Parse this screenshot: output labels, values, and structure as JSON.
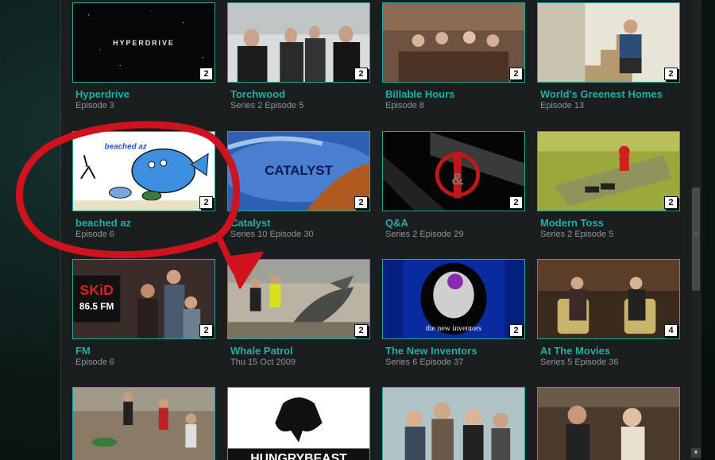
{
  "grid": {
    "tiles": [
      {
        "title": "Hyperdrive",
        "subtitle": "Episode 3",
        "badge": "2",
        "thumb_text": "HYPERDRIVE"
      },
      {
        "title": "Torchwood",
        "subtitle": "Series 2 Episode 5",
        "badge": "2"
      },
      {
        "title": "Billable Hours",
        "subtitle": "Episode 8",
        "badge": "2"
      },
      {
        "title": "World's Greenest Homes",
        "subtitle": "Episode 13",
        "badge": "2"
      },
      {
        "title": "beached az",
        "subtitle": "Episode 6",
        "badge": "2",
        "thumb_text": "beached az"
      },
      {
        "title": "Catalyst",
        "subtitle": "Series 10 Episode 30",
        "badge": "2",
        "thumb_text": "CATALYST"
      },
      {
        "title": "Q&A",
        "subtitle": "Series 2 Episode 29",
        "badge": "2",
        "thumb_text": "&"
      },
      {
        "title": "Modern Toss",
        "subtitle": "Series 2 Episode 5",
        "badge": "2"
      },
      {
        "title": "FM",
        "subtitle": "Episode 6",
        "badge": "2",
        "thumb_text_1": "SKiD",
        "thumb_text_2": "86.5 FM"
      },
      {
        "title": "Whale Patrol",
        "subtitle": "Thu 15 Oct 2009",
        "badge": "2"
      },
      {
        "title": "The New Inventors",
        "subtitle": "Series 6 Episode 37",
        "badge": "2",
        "thumb_text": "the new inventors"
      },
      {
        "title": "At The Movies",
        "subtitle": "Series 5 Episode 36",
        "badge": "4"
      },
      {
        "title": "",
        "subtitle": "",
        "badge": ""
      },
      {
        "title": "",
        "subtitle": "",
        "badge": "",
        "thumb_text": "HUNGRYBEAST"
      },
      {
        "title": "",
        "subtitle": "",
        "badge": ""
      },
      {
        "title": "",
        "subtitle": "",
        "badge": ""
      }
    ]
  },
  "scrollbar": {
    "grip": "≡",
    "down_arrow": "▼"
  },
  "colors": {
    "accent": "#1eb0a6",
    "annotation": "#d0121e",
    "panel": "#1b1e1e"
  }
}
